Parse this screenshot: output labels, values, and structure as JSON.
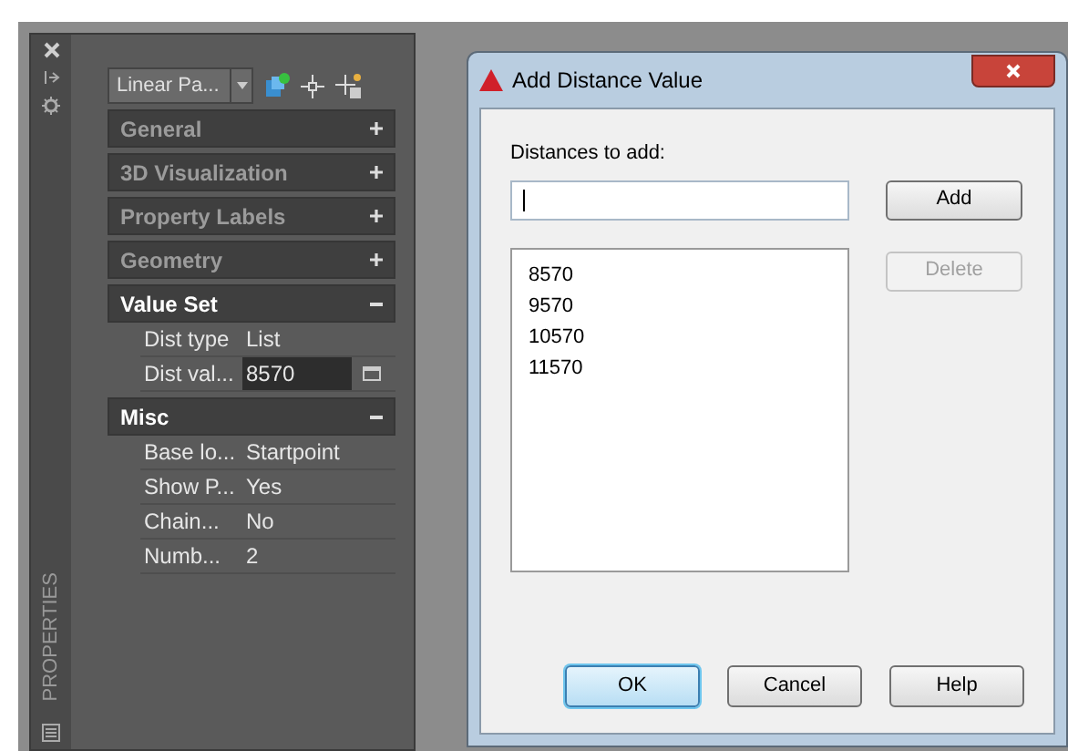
{
  "palette": {
    "side_label": "PROPERTIES",
    "dropdown": "Linear Pa...",
    "sections": [
      {
        "title": "General",
        "expanded": false
      },
      {
        "title": "3D Visualization",
        "expanded": false
      },
      {
        "title": "Property Labels",
        "expanded": false
      },
      {
        "title": "Geometry",
        "expanded": false
      },
      {
        "title": "Value Set",
        "expanded": true,
        "rows": [
          {
            "label": "Dist type",
            "value": "List",
            "kind": "text"
          },
          {
            "label": "Dist val...",
            "value": "8570",
            "kind": "edit"
          }
        ]
      },
      {
        "title": "Misc",
        "expanded": true,
        "rows": [
          {
            "label": "Base lo...",
            "value": "Startpoint",
            "kind": "text"
          },
          {
            "label": "Show P...",
            "value": "Yes",
            "kind": "text"
          },
          {
            "label": "Chain...",
            "value": "No",
            "kind": "text"
          },
          {
            "label": "Numb...",
            "value": "2",
            "kind": "text"
          }
        ]
      }
    ]
  },
  "dialog": {
    "title": "Add Distance Value",
    "field_label": "Distances to add:",
    "focused": true,
    "list": [
      "8570",
      "9570",
      "10570",
      "11570"
    ],
    "side_buttons": [
      {
        "label": "Add",
        "disabled": false
      },
      {
        "label": "Delete",
        "disabled": true
      }
    ],
    "buttons": [
      {
        "label": "OK",
        "default": true
      },
      {
        "label": "Cancel",
        "default": false
      },
      {
        "label": "Help",
        "default": false
      }
    ]
  }
}
